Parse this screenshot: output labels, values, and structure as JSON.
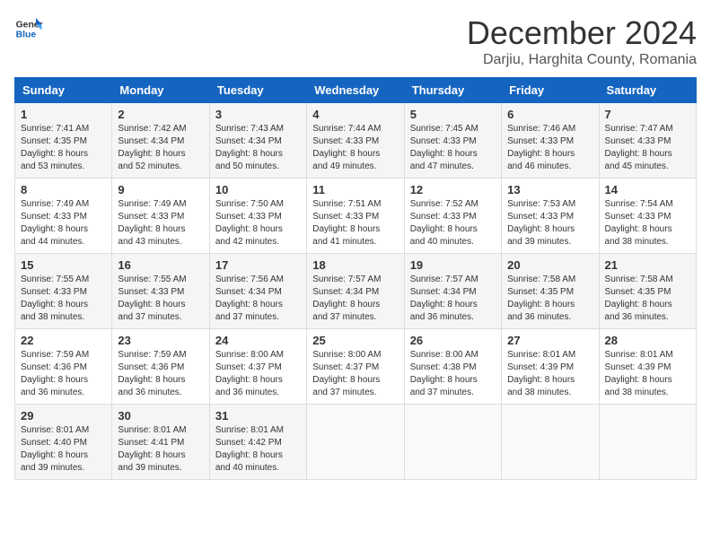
{
  "header": {
    "logo_general": "General",
    "logo_blue": "Blue",
    "month_title": "December 2024",
    "location": "Darjiu, Harghita County, Romania"
  },
  "weekdays": [
    "Sunday",
    "Monday",
    "Tuesday",
    "Wednesday",
    "Thursday",
    "Friday",
    "Saturday"
  ],
  "weeks": [
    [
      {
        "day": "1",
        "sunrise": "7:41 AM",
        "sunset": "4:35 PM",
        "daylight": "8 hours and 53 minutes."
      },
      {
        "day": "2",
        "sunrise": "7:42 AM",
        "sunset": "4:34 PM",
        "daylight": "8 hours and 52 minutes."
      },
      {
        "day": "3",
        "sunrise": "7:43 AM",
        "sunset": "4:34 PM",
        "daylight": "8 hours and 50 minutes."
      },
      {
        "day": "4",
        "sunrise": "7:44 AM",
        "sunset": "4:33 PM",
        "daylight": "8 hours and 49 minutes."
      },
      {
        "day": "5",
        "sunrise": "7:45 AM",
        "sunset": "4:33 PM",
        "daylight": "8 hours and 47 minutes."
      },
      {
        "day": "6",
        "sunrise": "7:46 AM",
        "sunset": "4:33 PM",
        "daylight": "8 hours and 46 minutes."
      },
      {
        "day": "7",
        "sunrise": "7:47 AM",
        "sunset": "4:33 PM",
        "daylight": "8 hours and 45 minutes."
      }
    ],
    [
      {
        "day": "8",
        "sunrise": "7:49 AM",
        "sunset": "4:33 PM",
        "daylight": "8 hours and 44 minutes."
      },
      {
        "day": "9",
        "sunrise": "7:49 AM",
        "sunset": "4:33 PM",
        "daylight": "8 hours and 43 minutes."
      },
      {
        "day": "10",
        "sunrise": "7:50 AM",
        "sunset": "4:33 PM",
        "daylight": "8 hours and 42 minutes."
      },
      {
        "day": "11",
        "sunrise": "7:51 AM",
        "sunset": "4:33 PM",
        "daylight": "8 hours and 41 minutes."
      },
      {
        "day": "12",
        "sunrise": "7:52 AM",
        "sunset": "4:33 PM",
        "daylight": "8 hours and 40 minutes."
      },
      {
        "day": "13",
        "sunrise": "7:53 AM",
        "sunset": "4:33 PM",
        "daylight": "8 hours and 39 minutes."
      },
      {
        "day": "14",
        "sunrise": "7:54 AM",
        "sunset": "4:33 PM",
        "daylight": "8 hours and 38 minutes."
      }
    ],
    [
      {
        "day": "15",
        "sunrise": "7:55 AM",
        "sunset": "4:33 PM",
        "daylight": "8 hours and 38 minutes."
      },
      {
        "day": "16",
        "sunrise": "7:55 AM",
        "sunset": "4:33 PM",
        "daylight": "8 hours and 37 minutes."
      },
      {
        "day": "17",
        "sunrise": "7:56 AM",
        "sunset": "4:34 PM",
        "daylight": "8 hours and 37 minutes."
      },
      {
        "day": "18",
        "sunrise": "7:57 AM",
        "sunset": "4:34 PM",
        "daylight": "8 hours and 37 minutes."
      },
      {
        "day": "19",
        "sunrise": "7:57 AM",
        "sunset": "4:34 PM",
        "daylight": "8 hours and 36 minutes."
      },
      {
        "day": "20",
        "sunrise": "7:58 AM",
        "sunset": "4:35 PM",
        "daylight": "8 hours and 36 minutes."
      },
      {
        "day": "21",
        "sunrise": "7:58 AM",
        "sunset": "4:35 PM",
        "daylight": "8 hours and 36 minutes."
      }
    ],
    [
      {
        "day": "22",
        "sunrise": "7:59 AM",
        "sunset": "4:36 PM",
        "daylight": "8 hours and 36 minutes."
      },
      {
        "day": "23",
        "sunrise": "7:59 AM",
        "sunset": "4:36 PM",
        "daylight": "8 hours and 36 minutes."
      },
      {
        "day": "24",
        "sunrise": "8:00 AM",
        "sunset": "4:37 PM",
        "daylight": "8 hours and 36 minutes."
      },
      {
        "day": "25",
        "sunrise": "8:00 AM",
        "sunset": "4:37 PM",
        "daylight": "8 hours and 37 minutes."
      },
      {
        "day": "26",
        "sunrise": "8:00 AM",
        "sunset": "4:38 PM",
        "daylight": "8 hours and 37 minutes."
      },
      {
        "day": "27",
        "sunrise": "8:01 AM",
        "sunset": "4:39 PM",
        "daylight": "8 hours and 38 minutes."
      },
      {
        "day": "28",
        "sunrise": "8:01 AM",
        "sunset": "4:39 PM",
        "daylight": "8 hours and 38 minutes."
      }
    ],
    [
      {
        "day": "29",
        "sunrise": "8:01 AM",
        "sunset": "4:40 PM",
        "daylight": "8 hours and 39 minutes."
      },
      {
        "day": "30",
        "sunrise": "8:01 AM",
        "sunset": "4:41 PM",
        "daylight": "8 hours and 39 minutes."
      },
      {
        "day": "31",
        "sunrise": "8:01 AM",
        "sunset": "4:42 PM",
        "daylight": "8 hours and 40 minutes."
      },
      null,
      null,
      null,
      null
    ]
  ]
}
